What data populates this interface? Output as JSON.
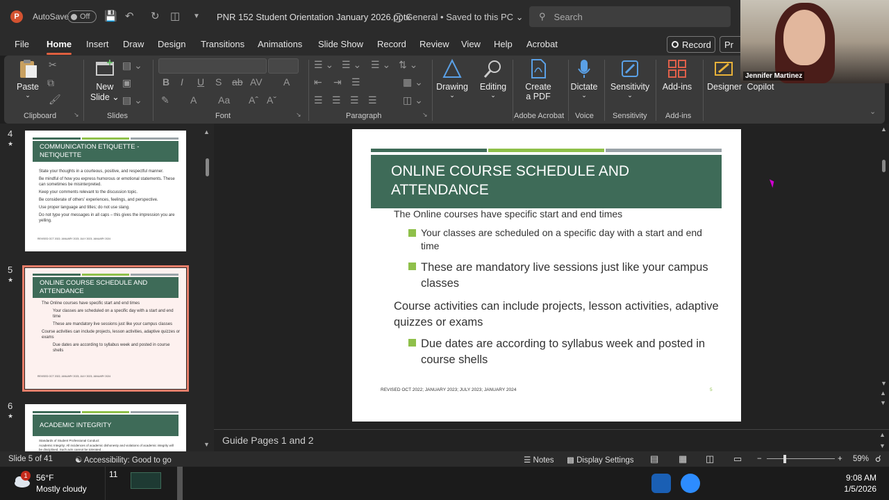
{
  "titlebar": {
    "app_letter": "P",
    "autosave_label": "AutoSave",
    "autosave_state": "Off",
    "document_title": "PNR 152 Student Orientation January 2026.pptx",
    "sensitivity": "General",
    "save_status": "Saved to this PC",
    "search_placeholder": "Search"
  },
  "webcam": {
    "participant_name": "Jennifer Martinez"
  },
  "menu": {
    "tabs": [
      "File",
      "Home",
      "Insert",
      "Draw",
      "Design",
      "Transitions",
      "Animations",
      "Slide Show",
      "Record",
      "Review",
      "View",
      "Help",
      "Acrobat"
    ],
    "active_tab": "Home",
    "record_label": "Record",
    "present_label": "Pr"
  },
  "ribbon": {
    "paste_label": "Paste",
    "new_slide_label_1": "New",
    "new_slide_label_2": "Slide",
    "drawing_label": "Drawing",
    "editing_label": "Editing",
    "create_pdf_1": "Create",
    "create_pdf_2": "a PDF",
    "dictate_label": "Dictate",
    "sensitivity_label": "Sensitivity",
    "addins_label": "Add-ins",
    "designer_label": "Designer",
    "copilot_label": "Copilot",
    "groups": {
      "clipboard": "Clipboard",
      "slides": "Slides",
      "font": "Font",
      "paragraph": "Paragraph",
      "adobe": "Adobe Acrobat",
      "voice": "Voice",
      "sensitivity": "Sensitivity",
      "addins": "Add-ins"
    }
  },
  "thumbnails": {
    "slide4": {
      "number": "4",
      "title": "COMMUNICATION ETIQUETTE - NETIQUETTE",
      "bullets": [
        "State your thoughts in a courteous, positive, and respectful manner.",
        "Be mindful of how you express humorous or emotional statements. These can sometimes be misinterpreted.",
        "Keep your comments relevant to the discussion topic.",
        "Be considerate of others' experiences, feelings, and perspective.",
        "Use proper language and titles; do not use slang.",
        "Do not type your messages in all caps – this gives the impression you are yelling."
      ]
    },
    "slide5": {
      "number": "5",
      "title": "ONLINE COURSE SCHEDULE AND ATTENDANCE",
      "line1": "The Online courses have specific start and end times",
      "sub1": "Your classes are scheduled on a specific day with a start and end time",
      "sub2": "These are mandatory live sessions just like your campus classes",
      "line2": "Course activities can include projects, lesson activities, adaptive quizzes or exams",
      "sub3": "Due dates are according to syllabus week and posted in course shells"
    },
    "slide6": {
      "number": "6",
      "title": "ACADEMIC INTEGRITY",
      "line1": "Standards of Student Professional Conduct:",
      "line2": "Academic Integrity: All incidences of academic dishonesty and violations of academic integrity will be disciplined. Such acts cannot be tolerated..."
    }
  },
  "slide": {
    "title": "ONLINE COURSE SCHEDULE AND ATTENDANCE",
    "line1": "The Online courses have specific start and end times",
    "sub1": "Your classes are scheduled on a specific day with a start and end time",
    "sub2": "These are mandatory live sessions just like your campus classes",
    "line2": "Course activities can include projects, lesson activities, adaptive quizzes or exams",
    "sub3": "Due dates are according to syllabus week and posted in course shells",
    "footer": "REVISED OCT 2022; JANUARY 2023; JULY 2023; JANUARY 2024",
    "page_number": "5",
    "band_colors": [
      "#3e6b58",
      "#8fc04a",
      "#9aa3a8"
    ],
    "title_bg": "#3e6b58"
  },
  "notes": {
    "text": "Guide Pages 1 and 2"
  },
  "statusbar": {
    "slide_counter": "Slide 5 of 41",
    "accessibility": "Accessibility: Good to go",
    "notes_label": "Notes",
    "display_settings": "Display Settings",
    "zoom": "59%",
    "zoom_level": 0.59
  },
  "taskbar": {
    "weather_badge": "1",
    "temperature": "56°F",
    "condition": "Mostly cloudy",
    "window_count": "11",
    "time": "9:08 AM",
    "date": "1/5/2026"
  }
}
